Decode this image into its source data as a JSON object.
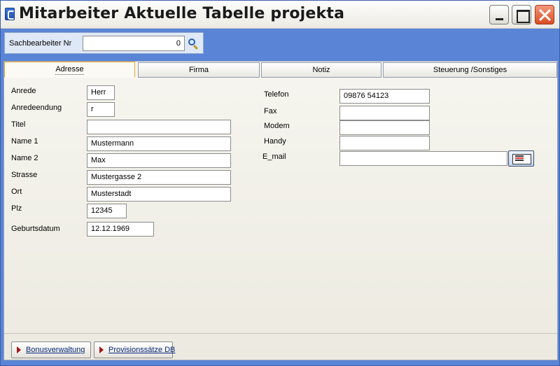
{
  "window": {
    "title": "Mitarbeiter Aktuelle Tabelle projekta"
  },
  "search": {
    "label": "Sachbearbeiter Nr",
    "value": "0"
  },
  "tabs": [
    {
      "label": "Adresse",
      "active": true
    },
    {
      "label": "Firma",
      "active": false
    },
    {
      "label": "Notiz",
      "active": false
    },
    {
      "label": "Steuerung /Sonstiges",
      "active": false
    }
  ],
  "address": {
    "anrede": {
      "label": "Anrede",
      "value": "Herr"
    },
    "anredeendung": {
      "label": "Anredeendung",
      "value": "r"
    },
    "titel": {
      "label": "Titel",
      "value": ""
    },
    "name1": {
      "label": "Name 1",
      "value": "Mustermann"
    },
    "name2": {
      "label": "Name 2",
      "value": "Max"
    },
    "strasse": {
      "label": "Strasse",
      "value": "Mustergasse 2"
    },
    "ort": {
      "label": "Ort",
      "value": "Musterstadt"
    },
    "plz": {
      "label": "Plz",
      "value": "12345"
    },
    "geburtsdatum": {
      "label": "Geburtsdatum",
      "value": "12.12.1969"
    }
  },
  "contact": {
    "telefon": {
      "label": "Telefon",
      "value": "09876 54123"
    },
    "fax": {
      "label": "Fax",
      "value": ""
    },
    "modem": {
      "label": "Modem",
      "value": ""
    },
    "handy": {
      "label": "Handy",
      "value": ""
    },
    "email": {
      "label": "E_mail",
      "value": ""
    }
  },
  "buttons": {
    "bonus": "Bonusverwaltung",
    "provision": "Provisionssätze DB"
  },
  "colors": {
    "frame": "#5a84d6",
    "active_tab_border": "#e6a92c",
    "close_button": "#d94b22"
  }
}
